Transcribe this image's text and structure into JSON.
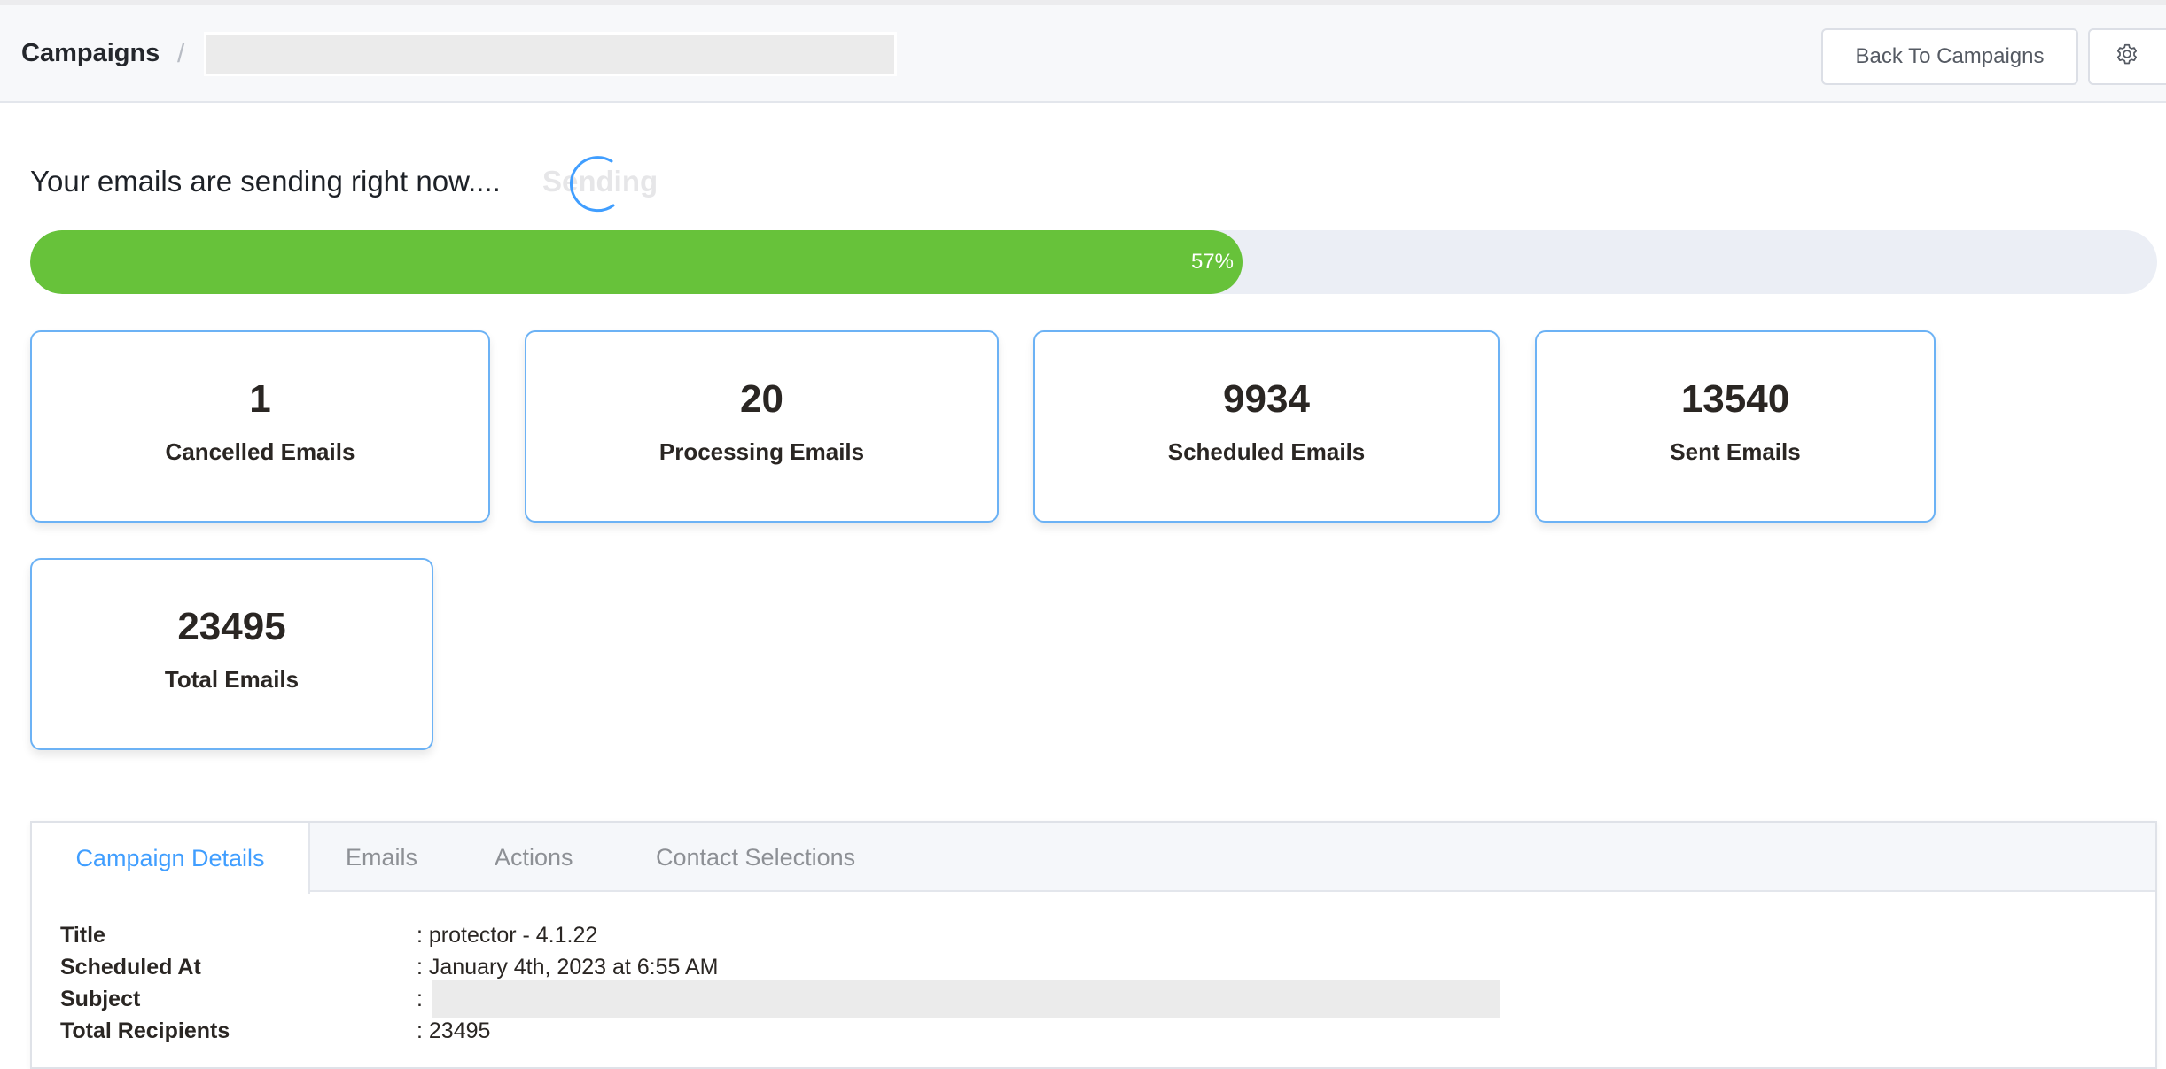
{
  "header": {
    "breadcrumb_root": "Campaigns",
    "breadcrumb_separator": "/",
    "breadcrumb_current_redacted": true,
    "back_button_label": "Back To Campaigns",
    "settings_icon": "gear-icon"
  },
  "status": {
    "heading": "Your emails are sending right now....",
    "loading_text": "Sending",
    "spinner_icon": "loading-spinner-icon"
  },
  "progress": {
    "percent": 57,
    "label": "57%",
    "fill_color": "#67c23a",
    "track_color": "#ebeef5"
  },
  "stats": [
    {
      "value": "1",
      "label": "Cancelled Emails"
    },
    {
      "value": "20",
      "label": "Processing Emails"
    },
    {
      "value": "9934",
      "label": "Scheduled Emails"
    },
    {
      "value": "13540",
      "label": "Sent Emails"
    },
    {
      "value": "23495",
      "label": "Total Emails"
    }
  ],
  "tabs": [
    {
      "label": "Campaign Details",
      "active": true
    },
    {
      "label": "Emails",
      "active": false
    },
    {
      "label": "Actions",
      "active": false
    },
    {
      "label": "Contact Selections",
      "active": false
    }
  ],
  "details": [
    {
      "label": "Title",
      "value": ": protector - 4.1.22"
    },
    {
      "label": "Scheduled At",
      "value": ": January 4th, 2023 at 6:55 AM"
    },
    {
      "label": "Subject",
      "value": ":",
      "redacted": true
    },
    {
      "label": "Total Recipients",
      "value": ": 23495"
    }
  ],
  "colors": {
    "accent": "#409eff",
    "card_border": "#6cb2f5",
    "success": "#67c23a"
  }
}
